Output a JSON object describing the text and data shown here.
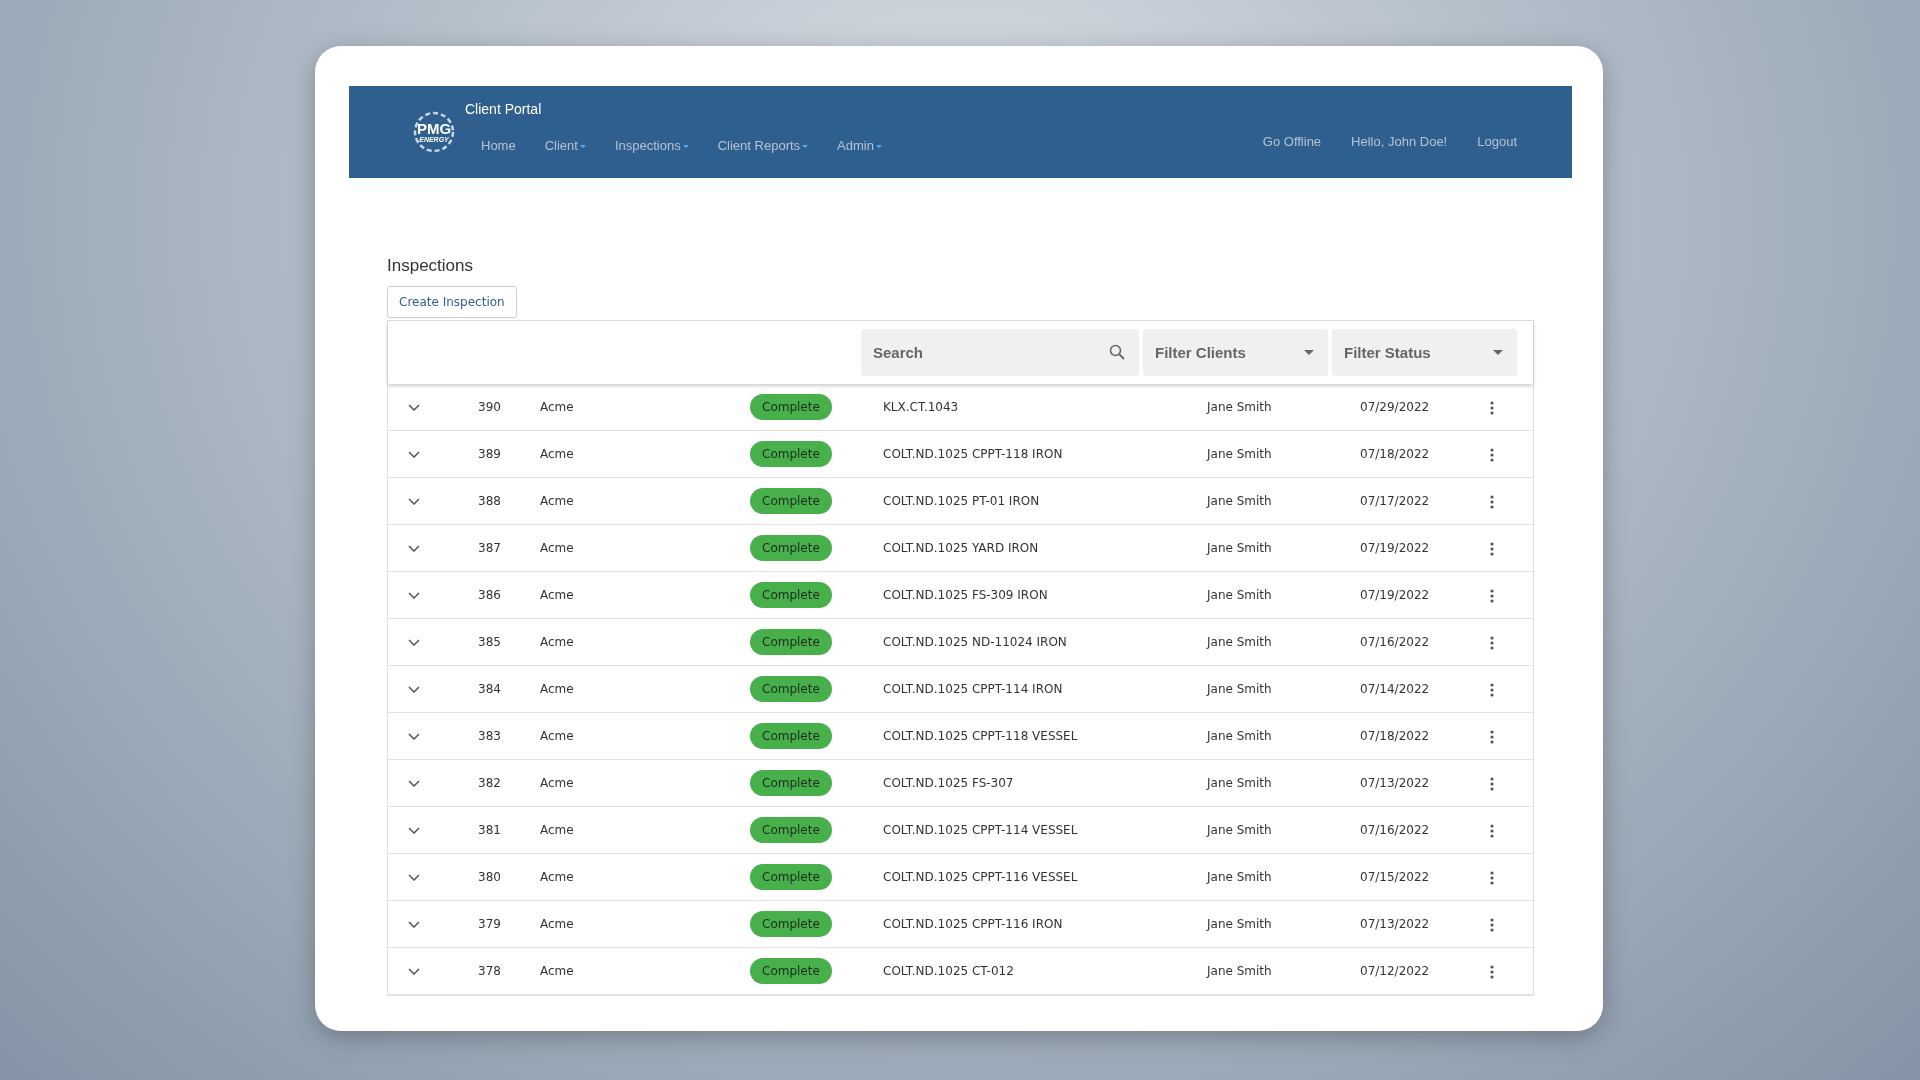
{
  "navbar": {
    "logo": {
      "text": "PMG",
      "subtext": "ENERGY"
    },
    "title": "Client Portal",
    "left_items": [
      {
        "label": "Home",
        "dropdown": false
      },
      {
        "label": "Client",
        "dropdown": true
      },
      {
        "label": "Inspections",
        "dropdown": true
      },
      {
        "label": "Client Reports",
        "dropdown": true
      },
      {
        "label": "Admin",
        "dropdown": true
      }
    ],
    "right_items": [
      {
        "label": "Go Offline"
      },
      {
        "label": "Hello, John Doe!"
      },
      {
        "label": "Logout"
      }
    ]
  },
  "page_title": "Inspections",
  "create_button": "Create Inspection",
  "toolbar": {
    "search": {
      "placeholder": "Search"
    },
    "filters": [
      {
        "label": "Filter Clients"
      },
      {
        "label": "Filter Status"
      }
    ]
  },
  "rows": [
    {
      "id": "390",
      "client": "Acme",
      "status": "Complete",
      "name": "KLX.CT.1043",
      "inspector": "Jane Smith",
      "date": "07/29/2022"
    },
    {
      "id": "389",
      "client": "Acme",
      "status": "Complete",
      "name": "COLT.ND.1025 CPPT-118 IRON",
      "inspector": "Jane Smith",
      "date": "07/18/2022"
    },
    {
      "id": "388",
      "client": "Acme",
      "status": "Complete",
      "name": "COLT.ND.1025 PT-01 IRON",
      "inspector": "Jane Smith",
      "date": "07/17/2022"
    },
    {
      "id": "387",
      "client": "Acme",
      "status": "Complete",
      "name": "COLT.ND.1025 YARD IRON",
      "inspector": "Jane Smith",
      "date": "07/19/2022"
    },
    {
      "id": "386",
      "client": "Acme",
      "status": "Complete",
      "name": "COLT.ND.1025 FS-309 IRON",
      "inspector": "Jane Smith",
      "date": "07/19/2022"
    },
    {
      "id": "385",
      "client": "Acme",
      "status": "Complete",
      "name": "COLT.ND.1025 ND-11024 IRON",
      "inspector": "Jane Smith",
      "date": "07/16/2022"
    },
    {
      "id": "384",
      "client": "Acme",
      "status": "Complete",
      "name": "COLT.ND.1025 CPPT-114 IRON",
      "inspector": "Jane Smith",
      "date": "07/14/2022"
    },
    {
      "id": "383",
      "client": "Acme",
      "status": "Complete",
      "name": "COLT.ND.1025 CPPT-118 VESSEL",
      "inspector": "Jane Smith",
      "date": "07/18/2022"
    },
    {
      "id": "382",
      "client": "Acme",
      "status": "Complete",
      "name": "COLT.ND.1025 FS-307",
      "inspector": "Jane Smith",
      "date": "07/13/2022"
    },
    {
      "id": "381",
      "client": "Acme",
      "status": "Complete",
      "name": "COLT.ND.1025 CPPT-114 VESSEL",
      "inspector": "Jane Smith",
      "date": "07/16/2022"
    },
    {
      "id": "380",
      "client": "Acme",
      "status": "Complete",
      "name": "COLT.ND.1025 CPPT-116 VESSEL",
      "inspector": "Jane Smith",
      "date": "07/15/2022"
    },
    {
      "id": "379",
      "client": "Acme",
      "status": "Complete",
      "name": "COLT.ND.1025 CPPT-116 IRON",
      "inspector": "Jane Smith",
      "date": "07/13/2022"
    },
    {
      "id": "378",
      "client": "Acme",
      "status": "Complete",
      "name": "COLT.ND.1025 CT-012",
      "inspector": "Jane Smith",
      "date": "07/12/2022"
    }
  ]
}
